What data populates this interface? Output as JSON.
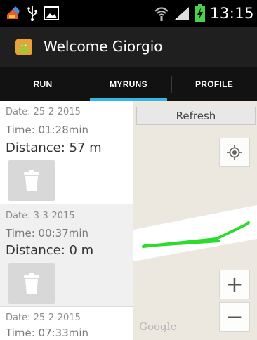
{
  "status_bar": {
    "time": "13:15",
    "icons": [
      "usb-icon",
      "picture-icon",
      "wifi-icon",
      "signal-icon",
      "battery-charging-icon",
      "notification-app-icon"
    ]
  },
  "action_bar": {
    "title": "Welcome Giorgio",
    "icon": "android-icon"
  },
  "tabs": [
    {
      "label": "RUN",
      "active": false
    },
    {
      "label": "MYRUNS",
      "active": true
    },
    {
      "label": "PROFILE",
      "active": false
    }
  ],
  "runs": [
    {
      "date": "Date: 25-2-2015",
      "time": "Time: 01:28min",
      "distance": "Distance: 57 m",
      "icon": "trash-icon"
    },
    {
      "date": "Date: 3-3-2015",
      "time": "Time: 00:37min",
      "distance": "Distance: 0 m",
      "icon": "trash-icon"
    },
    {
      "date": "Date: 25-2-2015",
      "time": "Time: 07:33min"
    }
  ],
  "map": {
    "refresh_label": "Refresh",
    "zoom_in_label": "+",
    "zoom_out_label": "−",
    "attribution": "Google",
    "route_color": "#2cdc2c",
    "icons": [
      "my-location-icon"
    ]
  },
  "colors": {
    "accent": "#33b5e5",
    "action_bar": "#1f1f1f",
    "tab_bar": "#121212"
  }
}
